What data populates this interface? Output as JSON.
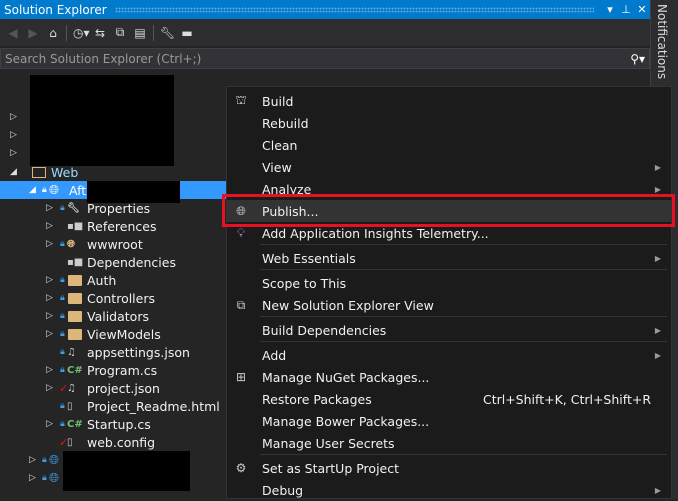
{
  "panel": {
    "title": "Solution Explorer",
    "title_buttons": [
      "▾",
      "⊥",
      "✕"
    ],
    "search_placeholder": "Search Solution Explorer (Ctrl+;)"
  },
  "toolbar": {
    "icons": [
      "back-icon",
      "forward-icon",
      "home-icon",
      "history-icon",
      "sync-icon",
      "collapse-all-icon",
      "show-all-files-icon",
      "properties-icon",
      "preview-icon"
    ]
  },
  "side_tab": {
    "label": "Notifications"
  },
  "tree": {
    "web": "Web",
    "project": "Aft.",
    "items": [
      {
        "label": "Properties"
      },
      {
        "label": "References"
      },
      {
        "label": "wwwroot"
      },
      {
        "label": "Dependencies"
      },
      {
        "label": "Auth"
      },
      {
        "label": "Controllers"
      },
      {
        "label": "Validators"
      },
      {
        "label": "ViewModels"
      },
      {
        "label": "appsettings.json"
      },
      {
        "label": "Program.cs"
      },
      {
        "label": "project.json"
      },
      {
        "label": "Project_Readme.html"
      },
      {
        "label": "Startup.cs"
      },
      {
        "label": "web.config"
      }
    ]
  },
  "menu": {
    "items": [
      {
        "label": "Build",
        "icon": "build-icon"
      },
      {
        "label": "Rebuild"
      },
      {
        "label": "Clean"
      },
      {
        "label": "View",
        "submenu": true
      },
      {
        "label": "Analyze",
        "submenu": true
      },
      {
        "label": "Publish...",
        "icon": "publish-globe-icon",
        "highlighted": true
      },
      {
        "label": "Add Application Insights Telemetry...",
        "icon": "lightbulb-icon"
      },
      {
        "label": "Web Essentials",
        "submenu": true
      },
      {
        "label": "Scope to This"
      },
      {
        "label": "New Solution Explorer View",
        "icon": "new-window-icon"
      },
      {
        "label": "Build Dependencies",
        "submenu": true
      },
      {
        "label": "Add",
        "submenu": true
      },
      {
        "label": "Manage NuGet Packages...",
        "icon": "nuget-icon"
      },
      {
        "label": "Restore Packages",
        "shortcut": "Ctrl+Shift+K, Ctrl+Shift+R"
      },
      {
        "label": "Manage Bower Packages..."
      },
      {
        "label": "Manage User Secrets"
      },
      {
        "label": "Set as StartUp Project",
        "icon": "gear-icon"
      },
      {
        "label": "Debug",
        "submenu": true
      }
    ]
  },
  "colors": {
    "accent": "#007acc",
    "selection": "#3399ff",
    "highlight_box": "#e81123"
  }
}
